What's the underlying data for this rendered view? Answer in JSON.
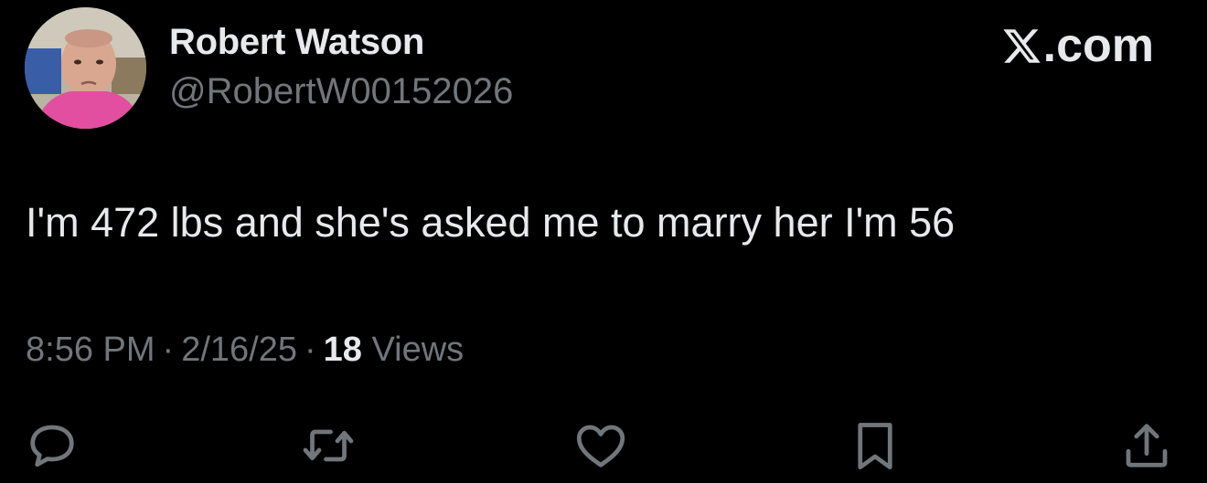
{
  "author": {
    "display_name": "Robert Watson",
    "handle": "@RobertW00152026",
    "avatar": "profile-photo"
  },
  "brand": {
    "logo_icon": "x-logo-icon",
    "label": ".com"
  },
  "tweet": {
    "text": "I'm 472 lbs and she's asked me to marry her I'm 56",
    "time": "8:56 PM",
    "date": "2/16/25",
    "separator": "·",
    "views_count": "18",
    "views_label": "Views"
  },
  "actions": [
    {
      "name": "reply",
      "icon": "speech-bubble-icon"
    },
    {
      "name": "repost",
      "icon": "repost-arrows-icon"
    },
    {
      "name": "like",
      "icon": "heart-icon"
    },
    {
      "name": "bookmark",
      "icon": "bookmark-icon"
    },
    {
      "name": "share",
      "icon": "share-upload-icon"
    }
  ],
  "colors": {
    "background": "#000000",
    "primary_text": "#e7e9ea",
    "secondary_text": "#71767b"
  }
}
